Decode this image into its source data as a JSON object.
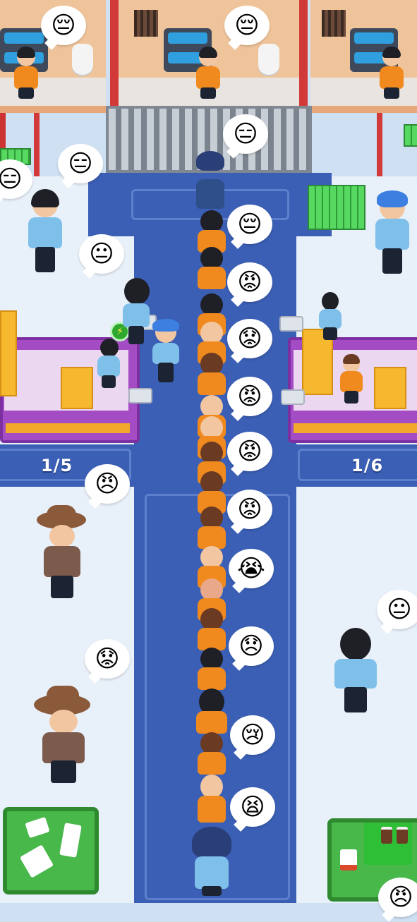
{
  "hud": {
    "left_desk_counter": "1/5",
    "right_desk_counter": "1/6"
  },
  "bubbles": [
    {
      "id": "cell-left",
      "emoji": "😔"
    },
    {
      "id": "cell-mid",
      "emoji": "😔"
    },
    {
      "id": "gate",
      "emoji": "😑"
    },
    {
      "id": "left-edge",
      "emoji": "😑"
    },
    {
      "id": "left-guard",
      "emoji": "😑"
    },
    {
      "id": "left-desk",
      "emoji": "😐"
    },
    {
      "id": "q1",
      "emoji": "😔"
    },
    {
      "id": "q2",
      "emoji": "😡"
    },
    {
      "id": "q3",
      "emoji": "😟"
    },
    {
      "id": "q4",
      "emoji": "😡"
    },
    {
      "id": "q5",
      "emoji": "😡"
    },
    {
      "id": "q6",
      "emoji": "😡"
    },
    {
      "id": "q7",
      "emoji": "😭"
    },
    {
      "id": "q8",
      "emoji": "😞"
    },
    {
      "id": "q9",
      "emoji": "😢"
    },
    {
      "id": "q10",
      "emoji": "😫"
    },
    {
      "id": "sheriff-1",
      "emoji": "😠"
    },
    {
      "id": "sheriff-2",
      "emoji": "😟"
    },
    {
      "id": "right-guard",
      "emoji": "😐"
    },
    {
      "id": "bottom-right",
      "emoji": "😠"
    }
  ],
  "colors": {
    "corridor": "#3b5fb5",
    "floor": "#e8f0f9",
    "prisoner": "#f08a1e",
    "guard": "#7fc0ea",
    "desk": "#a44cc4",
    "money": "#3fbf4a"
  }
}
